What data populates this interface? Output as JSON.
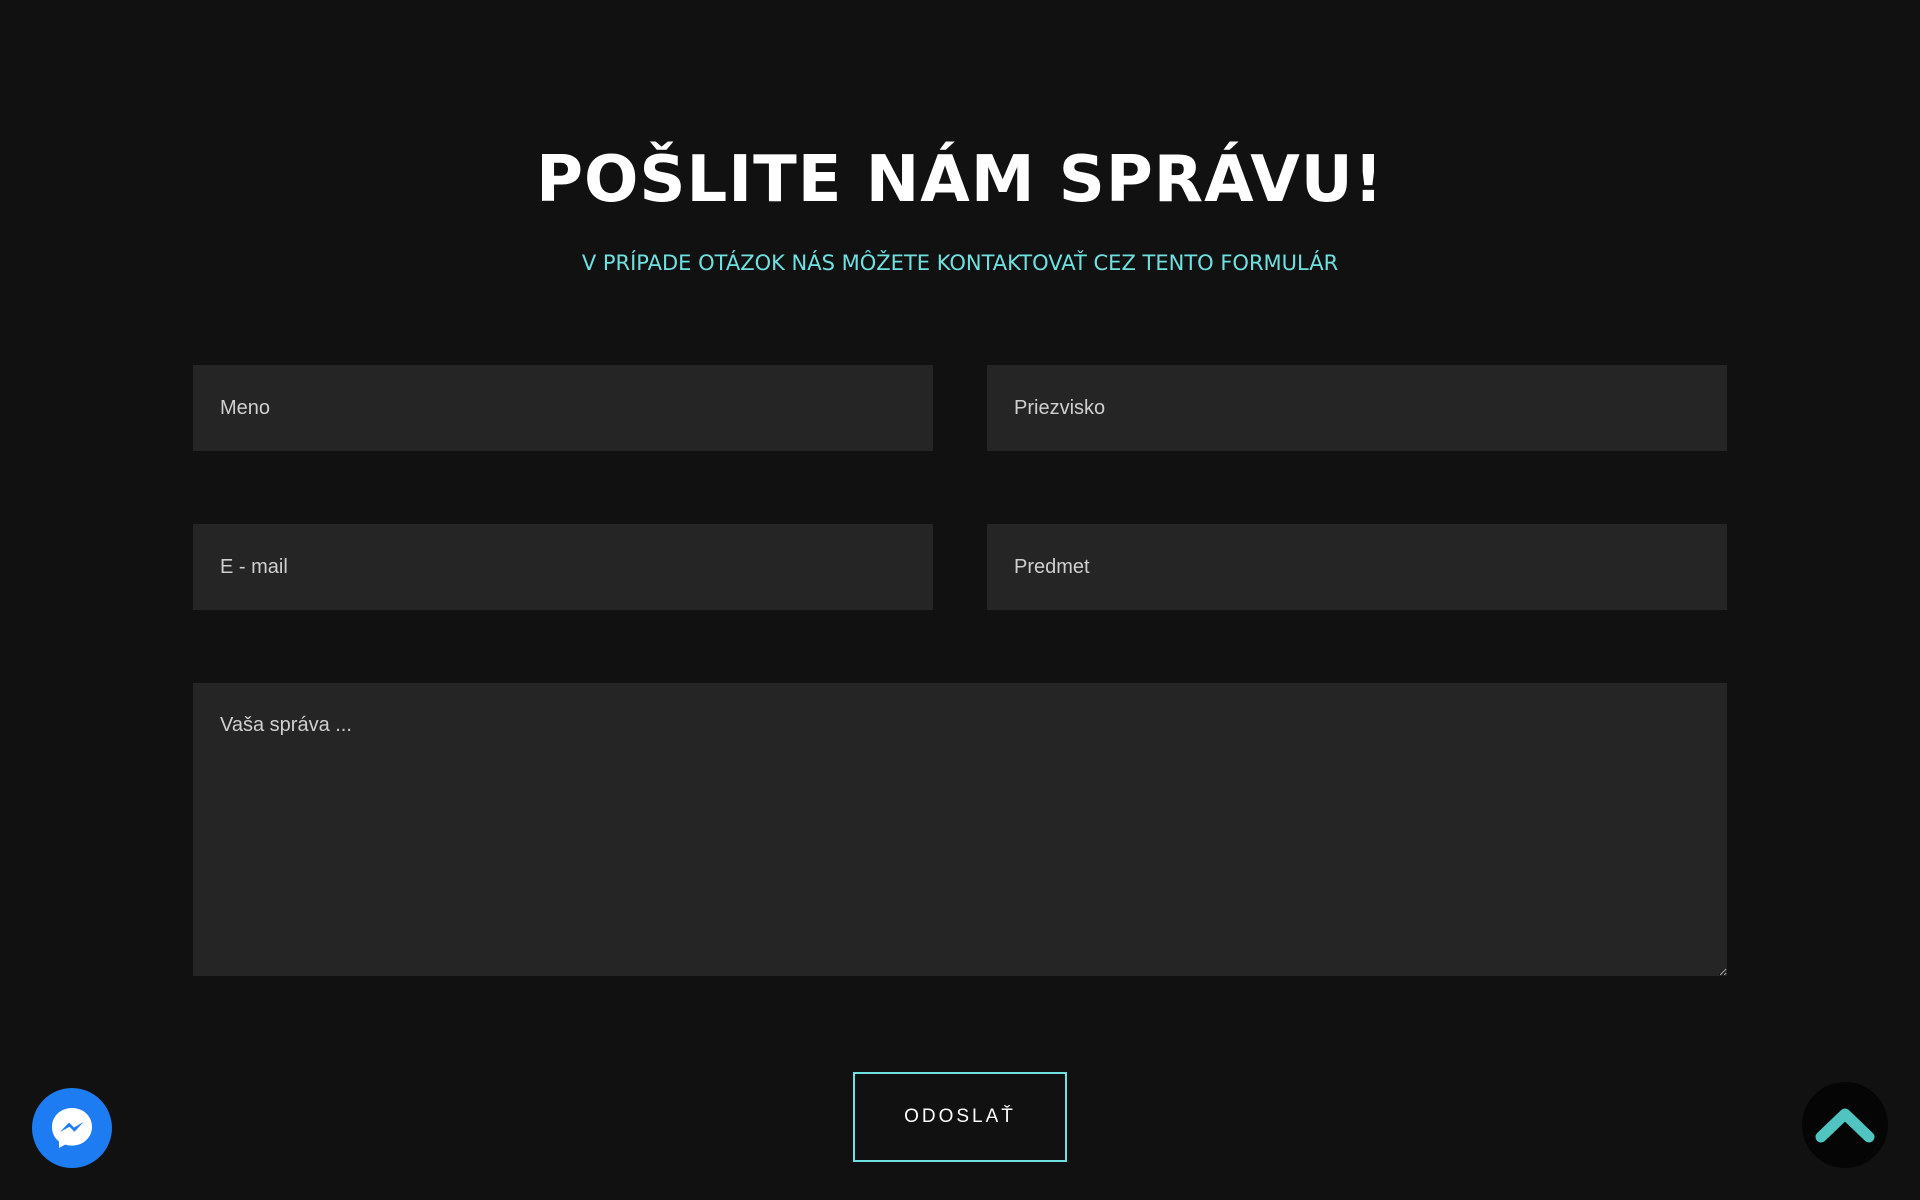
{
  "heading": {
    "title": "POŠLITE NÁM SPRÁVU!",
    "subtitle": "V PRÍPADE OTÁZOK NÁS MÔŽETE KONTAKTOVAŤ CEZ TENTO FORMULÁR"
  },
  "form": {
    "first_name_placeholder": "Meno",
    "last_name_placeholder": "Priezvisko",
    "email_placeholder": "E - mail",
    "subject_placeholder": "Predmet",
    "message_placeholder": "Vaša správa ...",
    "submit_label": "ODOSLAŤ"
  },
  "widgets": {
    "messenger_icon": "messenger-icon",
    "scroll_top_icon": "chevron-up-icon"
  },
  "colors": {
    "background": "#111111",
    "field_background": "#252525",
    "accent": "#6fe0e0",
    "messenger_blue": "#1d7cf2",
    "scroll_top_chevron": "#4fc4c0"
  }
}
